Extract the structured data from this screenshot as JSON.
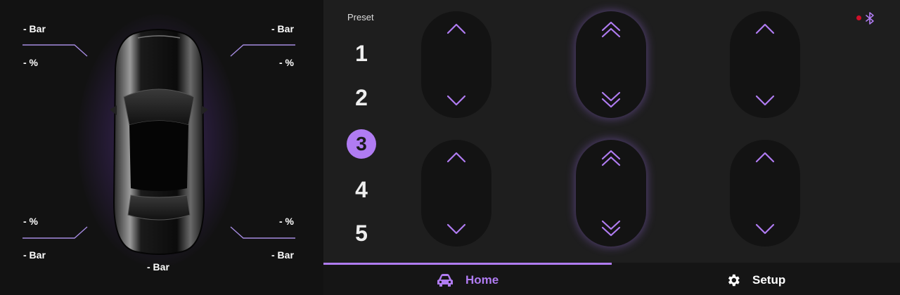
{
  "pressures": {
    "front_left": "- Bar",
    "front_right": "- Bar",
    "rear_left": "- Bar",
    "rear_right": "- Bar",
    "tank": "- Bar"
  },
  "heights": {
    "front_left": "- %",
    "front_right": "- %",
    "rear_left": "- %",
    "rear_right": "- %"
  },
  "presets": {
    "title": "Preset",
    "items": [
      "1",
      "2",
      "3",
      "4",
      "5"
    ],
    "active": "3"
  },
  "nav": {
    "home_label": "Home",
    "setup_label": "Setup",
    "active": "Home"
  },
  "status": {
    "bluetooth": "disconnected",
    "indicator_color": "#d0102a"
  },
  "icons": [
    "car-icon",
    "gear-icon",
    "bluetooth-icon",
    "chevron-up-icon",
    "chevron-down-icon",
    "double-chevron-up-icon",
    "double-chevron-down-icon"
  ],
  "colors": {
    "accent": "#b07cf2",
    "background": "#151515",
    "panel": "#1e1e1e"
  }
}
